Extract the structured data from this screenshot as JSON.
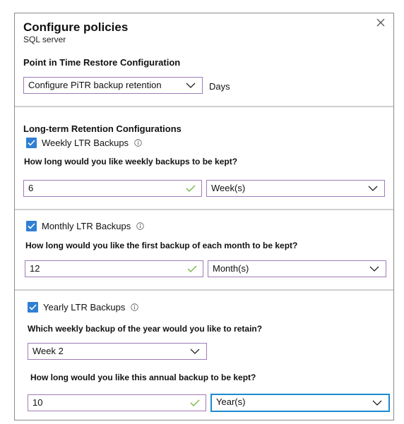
{
  "dialog": {
    "title": "Configure policies",
    "subtitle": "SQL server"
  },
  "pitr": {
    "heading": "Point in Time Restore Configuration",
    "select_value": "Configure PiTR backup retention",
    "unit_label": "Days"
  },
  "ltr": {
    "heading": "Long-term Retention Configurations",
    "weekly": {
      "checkbox_label": "Weekly LTR Backups",
      "checked": true,
      "question": "How long would you like weekly backups to be kept?",
      "value": "6",
      "unit": "Week(s)"
    },
    "monthly": {
      "checkbox_label": "Monthly LTR Backups",
      "checked": true,
      "question": "How long would you like the first backup of each month to be kept?",
      "value": "12",
      "unit": "Month(s)"
    },
    "yearly": {
      "checkbox_label": "Yearly LTR Backups",
      "checked": true,
      "week_question": "Which weekly backup of the year would you like to retain?",
      "week_value": "Week 2",
      "question": "How long would you like this annual backup to be kept?",
      "value": "10",
      "unit": "Year(s)"
    }
  },
  "colors": {
    "checkbox": "#2f7fd2",
    "valid_check": "#7ab648",
    "field_border": "#9e7cb8",
    "focus_border": "#1c8ad0"
  },
  "icons": {
    "close": "close-icon",
    "chevron": "chevron-down-icon",
    "check": "checkmark-icon",
    "info": "info-icon"
  }
}
